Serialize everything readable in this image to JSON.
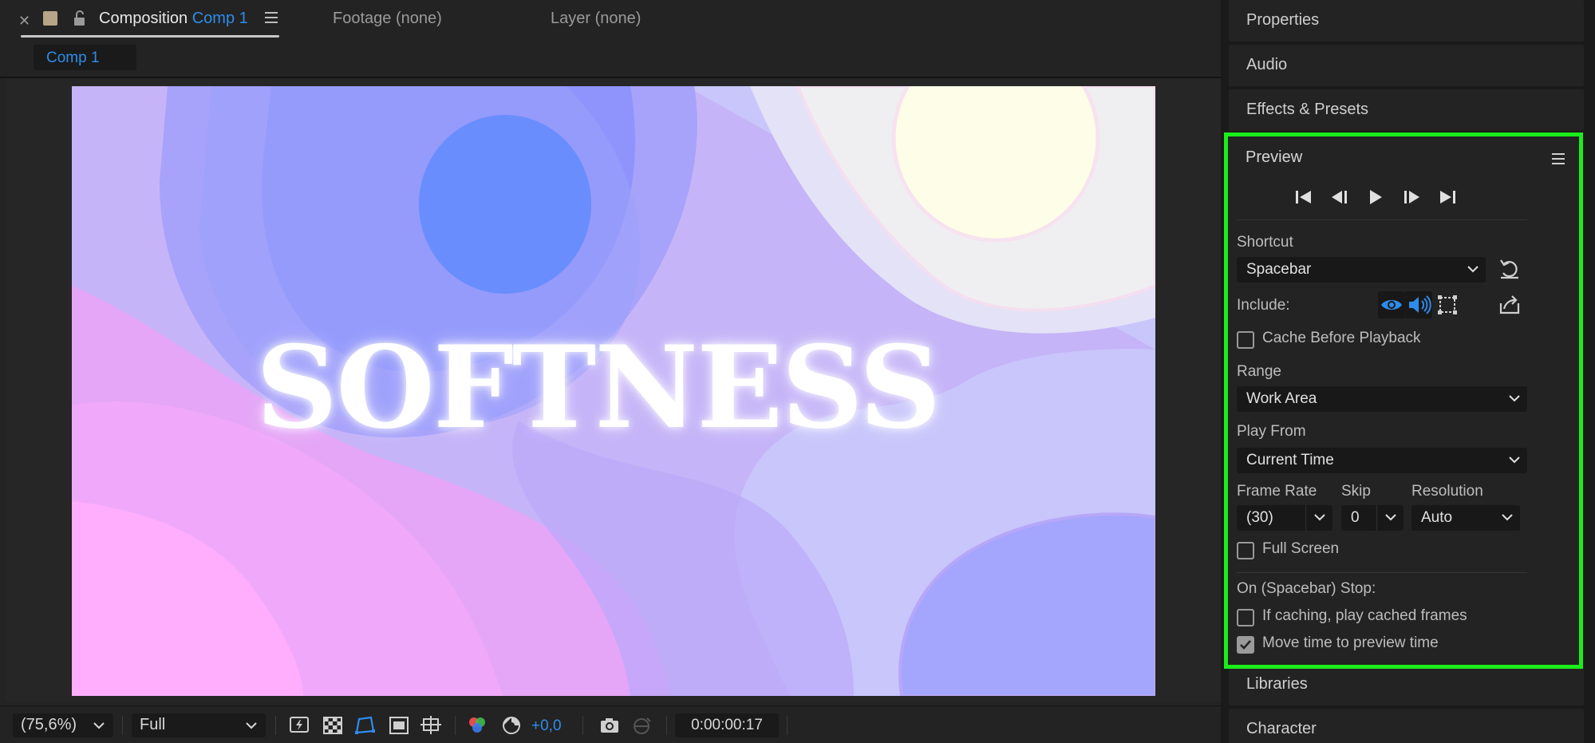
{
  "composition_panel": {
    "tabs": {
      "composition_prefix": "Composition",
      "composition_name": "Comp 1",
      "footage": "Footage (none)",
      "layer": "Layer (none)"
    },
    "subtab": "Comp 1",
    "canvas_text": "SOFTNESS",
    "toolbar": {
      "zoom": "(75,6%)",
      "resolution": "Full",
      "exposure": "+0,0",
      "timecode": "0:00:00:17"
    }
  },
  "right_panels": {
    "properties": "Properties",
    "audio": "Audio",
    "effects_presets": "Effects & Presets",
    "libraries": "Libraries",
    "character": "Character"
  },
  "preview": {
    "title": "Preview",
    "shortcut_label": "Shortcut",
    "shortcut_value": "Spacebar",
    "include_label": "Include:",
    "cache_before_playback": "Cache Before Playback",
    "range_label": "Range",
    "range_value": "Work Area",
    "play_from_label": "Play From",
    "play_from_value": "Current Time",
    "frame_rate_label": "Frame Rate",
    "frame_rate_value": "(30)",
    "skip_label": "Skip",
    "skip_value": "0",
    "resolution_label": "Resolution",
    "resolution_value": "Auto",
    "full_screen": "Full Screen",
    "stop_label": "On (Spacebar) Stop:",
    "if_caching": "If caching, play cached frames",
    "move_time": "Move time to preview time",
    "checkboxes": {
      "cache_before_playback": false,
      "full_screen": false,
      "if_caching": false,
      "move_time": true
    }
  },
  "colors": {
    "accent_blue": "#2d8ceb",
    "highlight_green": "#1aed1a",
    "panel_bg": "#232323"
  }
}
